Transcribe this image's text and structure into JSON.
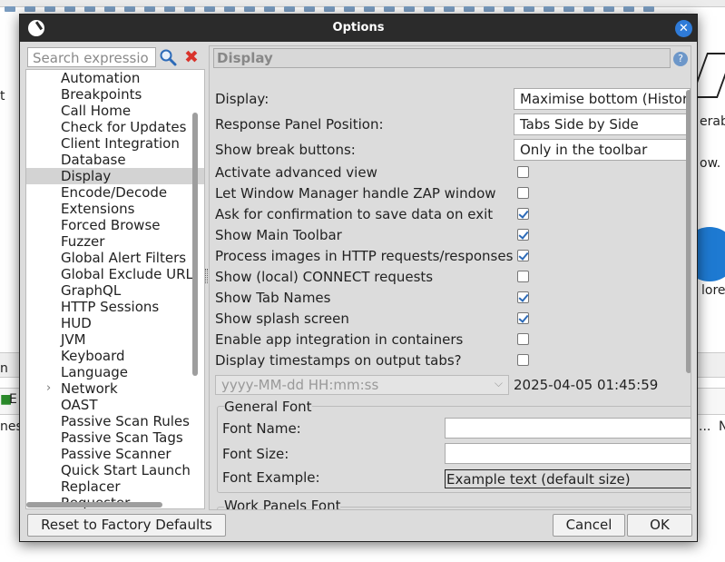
{
  "background": {
    "left_fragments": [
      "t",
      "n",
      "nes"
    ],
    "right_fragments": [
      "erab",
      "ow.",
      "lore",
      "...",
      "N"
    ],
    "strip_fragment": "E"
  },
  "dialog": {
    "title": "Options",
    "search_placeholder": "Search expressio",
    "tree_items": [
      {
        "label": "Automation"
      },
      {
        "label": "Breakpoints"
      },
      {
        "label": "Call Home"
      },
      {
        "label": "Check for Updates"
      },
      {
        "label": "Client Integration"
      },
      {
        "label": "Database"
      },
      {
        "label": "Display",
        "selected": true
      },
      {
        "label": "Encode/Decode"
      },
      {
        "label": "Extensions"
      },
      {
        "label": "Forced Browse"
      },
      {
        "label": "Fuzzer"
      },
      {
        "label": "Global Alert Filters"
      },
      {
        "label": "Global Exclude URL"
      },
      {
        "label": "GraphQL"
      },
      {
        "label": "HTTP Sessions"
      },
      {
        "label": "HUD"
      },
      {
        "label": "JVM"
      },
      {
        "label": "Keyboard"
      },
      {
        "label": "Language"
      },
      {
        "label": "Network",
        "expandable": true
      },
      {
        "label": "OAST"
      },
      {
        "label": "Passive Scan Rules"
      },
      {
        "label": "Passive Scan Tags"
      },
      {
        "label": "Passive Scanner"
      },
      {
        "label": "Quick Start Launch"
      },
      {
        "label": "Replacer"
      },
      {
        "label": "Requester"
      }
    ],
    "panel": {
      "header": "Display",
      "combos": [
        {
          "label": "Display:",
          "value": "Maximise bottom (Histor"
        },
        {
          "label": "Response Panel Position:",
          "value": "Tabs Side by Side"
        },
        {
          "label": "Show break buttons:",
          "value": "Only in the toolbar"
        }
      ],
      "checkboxes": [
        {
          "label": "Activate advanced view",
          "checked": false
        },
        {
          "label": "Let Window Manager handle ZAP window",
          "checked": false
        },
        {
          "label": "Ask for confirmation to save data on exit",
          "checked": true
        },
        {
          "label": "Show Main Toolbar",
          "checked": true
        },
        {
          "label": "Process images in HTTP requests/responses",
          "checked": true
        },
        {
          "label": "Show (local) CONNECT requests",
          "checked": false
        },
        {
          "label": "Show Tab Names",
          "checked": true
        },
        {
          "label": "Show splash screen",
          "checked": true
        },
        {
          "label": "Enable app integration in containers",
          "checked": false
        },
        {
          "label": "Display timestamps on output tabs?",
          "checked": false
        }
      ],
      "timestamp_format": "yyyy-MM-dd HH:mm:ss",
      "timestamp_example": "2025-04-05 01:45:59",
      "general_font": {
        "legend": "General Font",
        "name_label": "Font Name:",
        "size_label": "Font Size:",
        "example_label": "Font Example:",
        "example_text": "Example text (default size)"
      },
      "work_panels_font_legend": "Work Panels Font"
    },
    "buttons": {
      "reset": "Reset to Factory Defaults",
      "cancel": "Cancel",
      "ok": "OK"
    }
  },
  "colors": {
    "titlebar": "#2b2b2b",
    "close_button": "#2f7bd8",
    "checkmark": "#2d6bb8",
    "clear_icon": "#d9332b"
  }
}
